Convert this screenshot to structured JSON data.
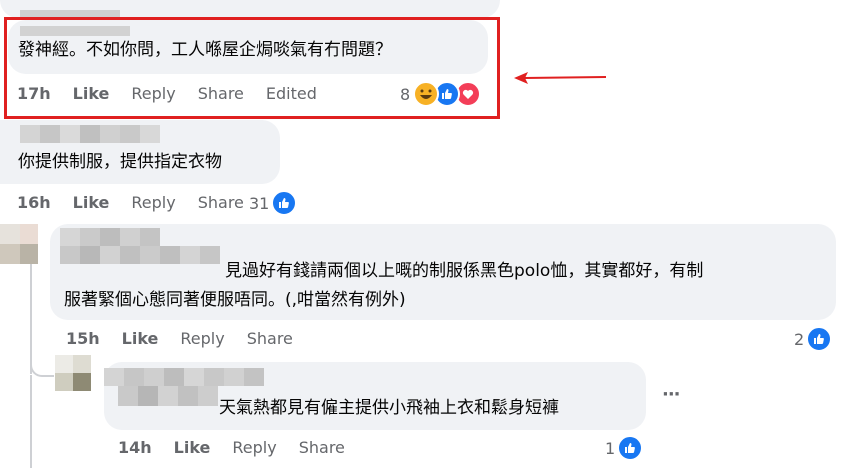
{
  "comments": [
    {
      "text": "發神經。不如你問，工人喺屋企焗啖氣有冇問題？",
      "time": "17h",
      "actions": [
        "Like",
        "Reply",
        "Share",
        "Edited"
      ],
      "reaction_count": "8",
      "reactions": [
        "haha-icon",
        "like-icon",
        "heart-icon"
      ]
    },
    {
      "text": "你提供制服，提供指定衣物",
      "time": "16h",
      "actions": [
        "Like",
        "Reply",
        "Share"
      ],
      "reaction_count": "31",
      "reactions": [
        "like-icon"
      ]
    },
    {
      "text_line1": "見過好有錢請兩個以上嘅的制服係黑色polo恤，其實都好，有制",
      "text_line2": "服著緊個心態同著便服唔同。(,咁當然有例外)",
      "time": "15h",
      "actions": [
        "Like",
        "Reply",
        "Share"
      ],
      "reaction_count": "2",
      "reactions": [
        "like-icon"
      ]
    },
    {
      "text": "天氣熱都見有僱主提供小飛袖上衣和鬆身短褲",
      "time": "14h",
      "actions": [
        "Like",
        "Reply",
        "Share"
      ],
      "reaction_count": "1",
      "reactions": [
        "like-icon"
      ],
      "more_label": "···"
    }
  ],
  "colors": {
    "bubble": "#f0f2f5",
    "meta_text": "#65676b",
    "highlight": "#e02020",
    "like_blue": "#1877f2",
    "heart_red": "#f33e58",
    "haha_yellow": "#f7b125"
  }
}
